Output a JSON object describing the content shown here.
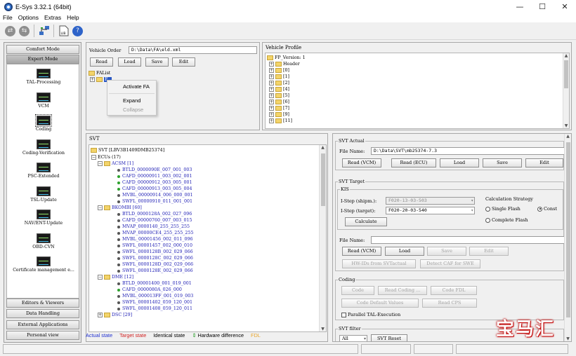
{
  "window": {
    "title": "E-Sys 3.32.1 (64bit)",
    "minimize": "—",
    "maximize": "☐",
    "close": "✕"
  },
  "menu": [
    "File",
    "Options",
    "Extras",
    "Help"
  ],
  "toolbar": {
    "lib_label": "LIB",
    "help": "?"
  },
  "sidebar": {
    "top_buttons": [
      "Comfort Mode",
      "Expert Mode"
    ],
    "items": [
      "TAL-Processing",
      "VCM",
      "Coding",
      "Coding-Verification",
      "PSC-Extended",
      "TSL-Update",
      "NAV/ENT-Update",
      "OBD-CVN",
      "Certificate management e..."
    ],
    "bottom_buttons": [
      "Editors & Viewers",
      "Data Handling",
      "External Applications",
      "Personal view"
    ]
  },
  "vehicle_order": {
    "label": "Vehicle Order",
    "path": "D:\\Data\\FA\\eld.xml",
    "buttons": [
      "Read",
      "Load",
      "Save",
      "Edit"
    ],
    "tree_root": "FAList",
    "tree_child": "F..."
  },
  "context_menu": {
    "items": [
      "Activate FA",
      "Expand",
      "Collapse"
    ]
  },
  "vehicle_profile": {
    "title": "Vehicle Profile",
    "rows": [
      "FP_Version: 1",
      "Header",
      "[0]",
      "[1]",
      "[2]",
      "[4]",
      "[5]",
      "[6]",
      "[7]",
      "[9]",
      "[11]"
    ]
  },
  "svt": {
    "title": "SVT",
    "root": "SVT [LBV3B1409DMB25374]",
    "ecus_label": "ECUs (17)",
    "groups": [
      {
        "name": "ACSM",
        "count": "[1]",
        "items": [
          "BTLD_0000090E_007_001_003",
          "CAFD_00000911_003_002_001",
          "CAFD_00000912_003_005_001",
          "CAFD_00000913_003_005_004",
          "MVBL_00000914_006_000_001",
          "SWFL_00000910_011_001_001"
        ]
      },
      {
        "name": "BKOMBI",
        "count": "[60]",
        "items": [
          "BTLD_0000128A_002_027_096",
          "CAFD_00000760_007_003_015",
          "MVAP_0000140_255_255_255",
          "MVAP_00000CE4_255_255_255",
          "MVBL_00001456_002_011_096",
          "SWFL_00001457_002_000_010",
          "SWFL_0000128B_002_029_066",
          "SWFL_0000128C_002_029_066",
          "SWFL_0000128D_002_029_066",
          "SWFL_0000128E_002_029_066"
        ]
      },
      {
        "name": "DME",
        "count": "[12]",
        "items": [
          "BTLD_00001400_001_019_001",
          "CAFD_0000080A_026_000",
          "MVBL_000013FF_001_019_003",
          "SWFL_00001402_059_120_001",
          "SWFL_00001408_059_120_011"
        ]
      },
      {
        "name": "DSC",
        "count": "[29]",
        "items": []
      }
    ]
  },
  "legend": [
    {
      "label": "Actual state",
      "color": "#1f2fd0"
    },
    {
      "label": "Target state",
      "color": "#d01f1f"
    },
    {
      "label": "Identical state",
      "color": "#000000"
    },
    {
      "label": "Hardware difference",
      "color": "#000000",
      "icon": "⇕"
    },
    {
      "label": "FDL",
      "color": "#e8a52a"
    }
  ],
  "svt_actual": {
    "title": "SVT Actual",
    "file_label": "File Name:",
    "file_value": "D:\\Data\\SVT\\mb25374-7.3",
    "buttons": [
      "Read (VCM)",
      "Read (ECU)",
      "Load",
      "Save",
      "Edit"
    ]
  },
  "svt_target": {
    "title": "SVT Target",
    "kis_label": "KIS",
    "istep_shipm_label": "I-Step (shipm.):",
    "istep_shipm_value": "F020-13-03-503",
    "istep_target_label": "I-Step (target):",
    "istep_target_value": "F020-20-03-540",
    "calc_strategy_label": "Calculation Strategy",
    "radio_single": "Single Flash",
    "radio_complete": "Complete Flash",
    "radio_const": "Const",
    "calculate_button": "Calculate",
    "file_label": "File Name:",
    "buttons": [
      "Read (VCM)",
      "Load",
      "Save",
      "Edit"
    ],
    "extra_buttons": [
      "HW-IDs from SVTactual",
      "Detect CAF for SWE"
    ]
  },
  "coding": {
    "title": "Coding",
    "buttons_row1": [
      "Code",
      "Read Coding ...",
      "Code FDL"
    ],
    "buttons_row2": [
      "Code Default Values",
      "Read CPS"
    ],
    "checkbox_label": "Parallel TAL-Execution"
  },
  "svt_filter": {
    "title": "SVT filter",
    "value": "All",
    "reset_button": "SVT Reset"
  },
  "watermark": "宝马汇"
}
